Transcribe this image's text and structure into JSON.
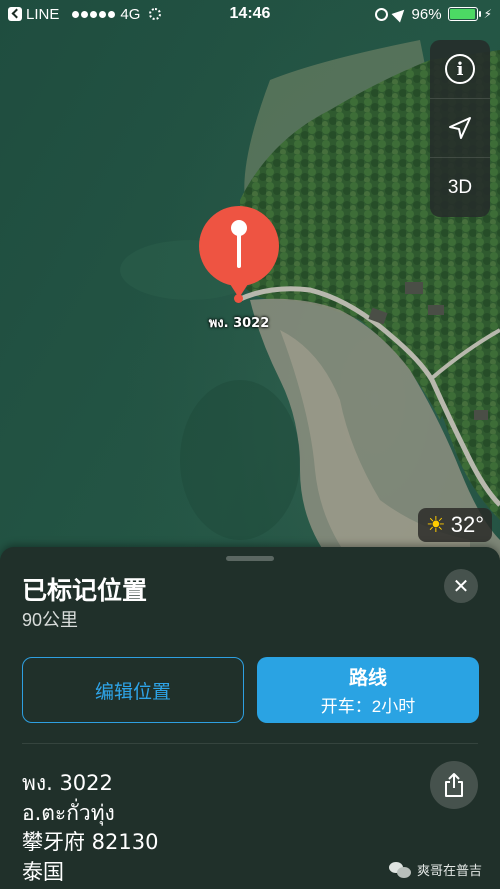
{
  "status_bar": {
    "back_app": "LINE",
    "network": "4G",
    "time": "14:46",
    "battery": "96%",
    "battery_level": 0.96,
    "battery_color": "#4cd964"
  },
  "map": {
    "type": "satellite",
    "pin_label": "พง. 3022",
    "pin_color": "#ee5442"
  },
  "map_controls": [
    {
      "icon": "info-icon",
      "label": "i"
    },
    {
      "icon": "location-arrow-icon",
      "label": ""
    },
    {
      "icon": "3d-icon",
      "label": "3D"
    }
  ],
  "weather": {
    "icon": "sun-icon",
    "temperature": "32°"
  },
  "sheet": {
    "title": "已标记位置",
    "distance": "90公里",
    "edit_button": "编辑位置",
    "route_button": "路线",
    "route_subtitle": "开车：2小时",
    "address_lines": [
      "พง. 3022",
      "อ.ตะกั่วทุ่ง",
      "攀牙府 82130",
      "泰国"
    ],
    "accent_color": "#2aa3e3"
  },
  "watermark": "爽哥在普吉"
}
